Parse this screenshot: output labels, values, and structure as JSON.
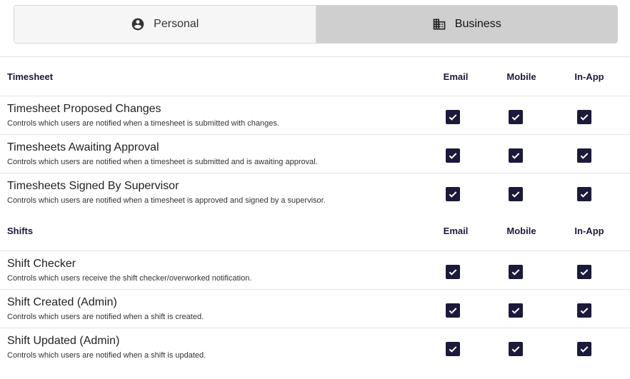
{
  "tabs": [
    {
      "label": "Personal",
      "icon": "account-circle-icon",
      "selected": false
    },
    {
      "label": "Business",
      "icon": "business-building-icon",
      "selected": true
    }
  ],
  "columns": [
    "Email",
    "Mobile",
    "In-App"
  ],
  "colors": {
    "accent": "#1c1a3a",
    "selected_tab": "#cfcfcf",
    "tab_bg": "#f6f6f6"
  },
  "sections": [
    {
      "title": "Timesheet",
      "rows": [
        {
          "title": "Timesheet Proposed Changes",
          "description": "Controls which users are notified when a timesheet is submitted with changes.",
          "email": true,
          "mobile": true,
          "inapp": true
        },
        {
          "title": "Timesheets Awaiting Approval",
          "description": "Controls which users are notified when a timesheet is submitted and is awaiting approval.",
          "email": true,
          "mobile": true,
          "inapp": true
        },
        {
          "title": "Timesheets Signed By Supervisor",
          "description": "Controls which users are notified when a timesheet is approved and signed by a supervisor.",
          "email": true,
          "mobile": true,
          "inapp": true
        }
      ]
    },
    {
      "title": "Shifts",
      "rows": [
        {
          "title": "Shift Checker",
          "description": "Controls which users receive the shift checker/overworked notification.",
          "email": true,
          "mobile": true,
          "inapp": true
        },
        {
          "title": "Shift Created (Admin)",
          "description": "Controls which users are notified when a shift is created.",
          "email": true,
          "mobile": true,
          "inapp": true
        },
        {
          "title": "Shift Updated (Admin)",
          "description": "Controls which users are notified when a shift is updated.",
          "email": true,
          "mobile": true,
          "inapp": true
        }
      ]
    }
  ]
}
